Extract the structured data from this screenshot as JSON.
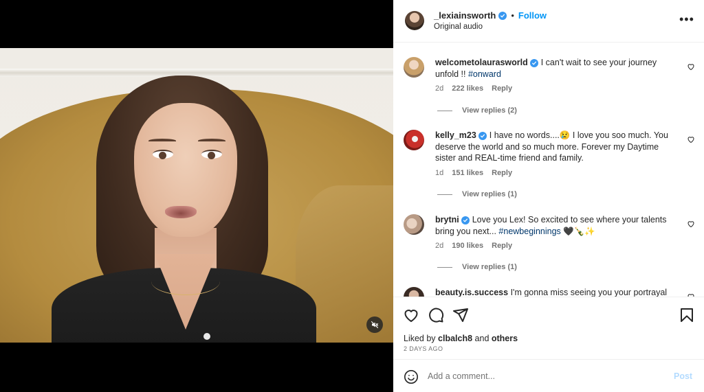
{
  "post": {
    "username": "_lexiainsworth",
    "separator": "•",
    "follow_label": "Follow",
    "subtitle": "Original audio"
  },
  "comments": [
    {
      "username": "welcometolaurasworld",
      "text": "I can't wait to see your journey unfold !! ",
      "hashtag": "#onward",
      "age": "2d",
      "likes": "222 likes",
      "reply_label": "Reply",
      "view_replies": "View replies (2)"
    },
    {
      "username": "kelly_m23",
      "text": "I have no words....😢 I love you soo much. You deserve the world and so much more. Forever my Daytime sister and REAL-time friend and family.",
      "age": "1d",
      "likes": "151 likes",
      "reply_label": "Reply",
      "view_replies": "View replies (1)"
    },
    {
      "username": "brytni",
      "text": "Love you Lex! So excited to see where your talents bring you next... ",
      "hashtag": "#newbeginnings",
      "emoji": " 🖤🍾✨",
      "age": "2d",
      "likes": "190 likes",
      "reply_label": "Reply",
      "view_replies": "View replies (1)"
    },
    {
      "username": "beauty.is.success",
      "text": "I'm gonna miss seeing you your portrayal"
    }
  ],
  "likes": {
    "prefix": "Liked by ",
    "user": "clbalch8",
    "middle": " and ",
    "others": "others"
  },
  "posted_date": "2 DAYS AGO",
  "composer": {
    "placeholder": "Add a comment...",
    "post_label": "Post"
  },
  "colors": {
    "accent": "#0095f6",
    "verified": "#3897f0",
    "post_disabled": "#b3dbff",
    "hashtag": "#00376b"
  },
  "icons": [
    "verified-badge-icon",
    "more-options-icon",
    "heart-icon",
    "comment-icon",
    "share-icon",
    "bookmark-icon",
    "emoji-icon",
    "muted-audio-icon"
  ]
}
